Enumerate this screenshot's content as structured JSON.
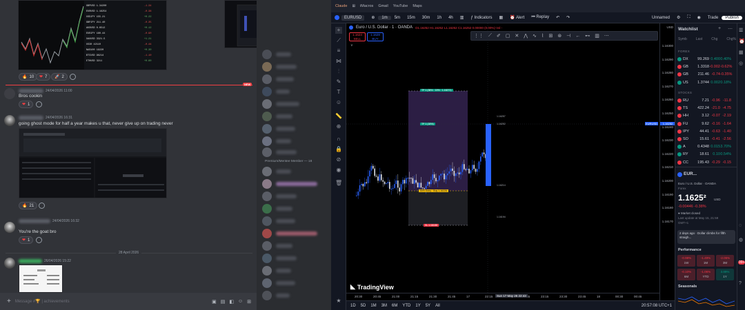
{
  "discord": {
    "top_reactions": [
      {
        "emoji": "🔥",
        "count": "10"
      },
      {
        "emoji": "❤",
        "count": "7"
      },
      {
        "emoji": "🚀",
        "count": "2"
      }
    ],
    "new_badge": "NEW",
    "messages": [
      {
        "time": "24/04/2026 11:00",
        "text": "Bros cookin",
        "reaction": {
          "emoji": "❤",
          "count": "1"
        }
      },
      {
        "time": "24/04/2026 16:31",
        "text": "going ghost mode for half a year makes u that, never give up on trading never",
        "reaction": {
          "emoji": "🔥",
          "count": "21"
        }
      },
      {
        "time": "24/04/2026 16:32",
        "text": "You're the goat bro",
        "reaction": {
          "emoji": "❤",
          "count": "1"
        }
      },
      {
        "time": "26/04/2026 15:22",
        "text": ""
      }
    ],
    "date_divider": "28 April 2026",
    "member_section": "Premium/Mentee Member — 18",
    "composer_placeholder": "Message #🏆 | achievements"
  },
  "tv": {
    "browser_tabs": [
      "Claude",
      "iMacros",
      "Gmail",
      "YouTube",
      "Maps"
    ],
    "symbol": "EURUSD",
    "timeframes": [
      "1m",
      "5m",
      "15m",
      "30m",
      "1h",
      "4h"
    ],
    "indicators_label": "Indicators",
    "alert_label": "Alert",
    "replay_label": "Replay",
    "layout_name": "Unnamed",
    "trade_label": "Trade",
    "publish_label": "Publish",
    "chart_title": "Euro / U.S. Dollar · 1 · OANDA",
    "ohlc": "O1.16252 H1.16252 L1.16252 C1.16252 0.00000 (0.00%) Vol -",
    "sell": {
      "price": "1.1624",
      "label": "SELL"
    },
    "buy": {
      "price": "1.1628",
      "label": "BUY"
    },
    "price_labels": [
      "1.16300",
      "1.16290",
      "1.16280",
      "1.16270",
      "1.16260",
      "1.16250",
      "1.16240",
      "1.16230",
      "1.16220",
      "1.16210",
      "1.16200",
      "1.16190",
      "1.16180",
      "1.16170"
    ],
    "current_price": "1.16252",
    "symbol_tag": "EURUSD",
    "time_labels": [
      "20:30",
      "20:45",
      "21:00",
      "21:15",
      "21:30",
      "21:45",
      "17",
      "22:15",
      "22:30",
      "22:45",
      "23:15",
      "23:30",
      "23:45",
      "18",
      "00:30",
      "00:45"
    ],
    "crosshair_time": "Sun 17 May 26  22:43",
    "range_buttons": [
      "1D",
      "5D",
      "1M",
      "3M",
      "6M",
      "YTD",
      "1Y",
      "5Y",
      "All"
    ],
    "clock": "20:57:08 UTC+1",
    "logo": "TradingView",
    "box_labels": {
      "top": "TP 1 (38% · 19% · 1.16271)",
      "mid": "TP 1 (18%)",
      "bot": "50% Entry · Buy 1.16226",
      "sl": "SL 1.16188"
    },
    "chart_points": {
      "r1": "1.16257",
      "r2": "1.16252",
      "r3": "1.16214",
      "r4": "1.16194"
    }
  },
  "watchlist": {
    "title": "Watchlist",
    "columns": [
      "Symb",
      "Last",
      "Chg",
      "Chg%"
    ],
    "forex_label": "FOREX",
    "forex": [
      {
        "sym": "DX",
        "last": "99.269",
        "chg": "0.400",
        "pct": "0.40%",
        "up": true
      },
      {
        "sym": "GB",
        "last": "1.3318",
        "chg": "-0.002",
        "pct": "-0.62%",
        "up": false
      },
      {
        "sym": "GB",
        "last": "211.46",
        "chg": "-0.74",
        "pct": "-0.35%",
        "up": false
      },
      {
        "sym": "US",
        "last": "1.3744",
        "chg": "0.002",
        "pct": "0.18%",
        "up": true
      }
    ],
    "stocks_label": "STOCKS",
    "stocks": [
      {
        "sym": "RU",
        "last": "7.21",
        "chg": "-0.96",
        "pct": "-11.8",
        "up": false
      },
      {
        "sym": "TS",
        "last": "422.24",
        "chg": "-21.0",
        "pct": "-4.75",
        "up": false
      },
      {
        "sym": "HH",
        "last": "3.12",
        "chg": "-0.07",
        "pct": "-2.19",
        "up": false
      },
      {
        "sym": "FU",
        "last": "9.62",
        "chg": "-0.16",
        "pct": "-1.64",
        "up": false
      },
      {
        "sym": "IPY",
        "last": "44.41",
        "chg": "-0.63",
        "pct": "-1.40",
        "up": false
      },
      {
        "sym": "SO",
        "last": "15.61",
        "chg": "-0.41",
        "pct": "-2.56",
        "up": false
      },
      {
        "sym": "A",
        "last": "0.4348",
        "chg": "0.015",
        "pct": "3.70%",
        "up": true
      },
      {
        "sym": "RY",
        "last": "18.61",
        "chg": "0.10",
        "pct": "0.54%",
        "up": true
      },
      {
        "sym": "CC",
        "last": "195.43",
        "chg": "-0.29",
        "pct": "-0.15",
        "up": false
      }
    ],
    "detail": {
      "sym": "EUR...",
      "name": "Euro / U.S. Dollar · OANDA",
      "type": "Forex",
      "price": "1.1625²",
      "ccy": "USD",
      "change": "-0.00446  -0.38%",
      "status": "● Market closed",
      "update": "Last update at May 15, 21:59",
      "src": "GMT+1",
      "news": "2 days ago · Dollar climbs for fifth straigh...",
      "perf_label": "Performance",
      "perf": [
        {
          "v": "-0.98%",
          "p": "1W",
          "up": false
        },
        {
          "v": "-1.49%",
          "p": "1M",
          "up": false
        },
        {
          "v": "-2.05%",
          "p": "3M",
          "up": false
        },
        {
          "v": "-0.10%",
          "p": "6M",
          "up": false
        },
        {
          "v": "-1.06%",
          "p": "YTD",
          "up": false
        },
        {
          "v": "3.89%",
          "p": "1Y",
          "up": true
        }
      ],
      "seasonals": "Seasonals"
    }
  },
  "colors": {
    "up": "#089981",
    "down": "#f23645",
    "accent": "#2962ff",
    "bg": "#131722"
  }
}
